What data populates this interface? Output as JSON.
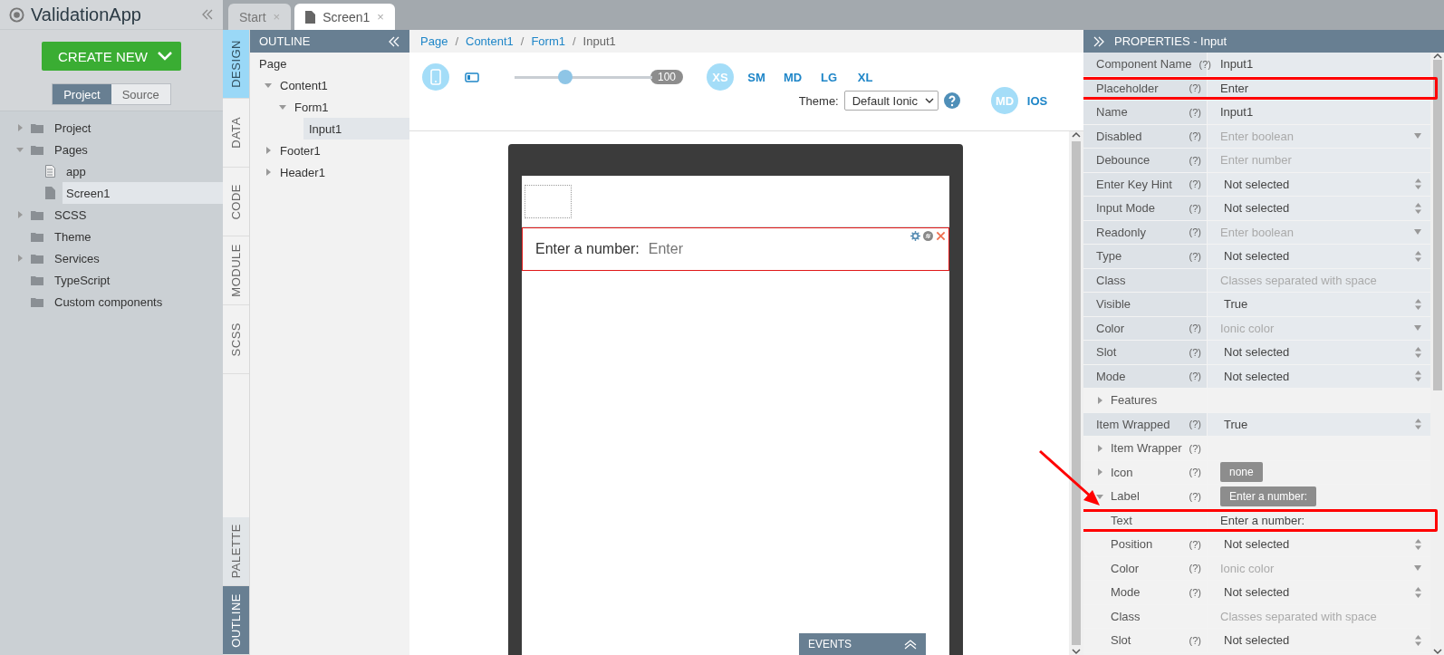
{
  "app": {
    "title": "ValidationApp",
    "create_button": "CREATE NEW",
    "source_tabs": [
      {
        "label": "Project",
        "selected": true
      },
      {
        "label": "Source",
        "selected": false
      }
    ],
    "tree": [
      {
        "label": "Project",
        "kind": "folder",
        "expanded": false,
        "selected": false
      },
      {
        "label": "Pages",
        "kind": "folder",
        "expanded": true,
        "selected": false,
        "children": [
          {
            "label": "app",
            "kind": "page",
            "selected": false
          },
          {
            "label": "Screen1",
            "kind": "file",
            "selected": true
          }
        ]
      },
      {
        "label": "SCSS",
        "kind": "folder",
        "expanded": false,
        "selected": false
      },
      {
        "label": "Theme",
        "kind": "folder",
        "selected": false
      },
      {
        "label": "Services",
        "kind": "folder",
        "expanded": false,
        "selected": false
      },
      {
        "label": "TypeScript",
        "kind": "folder",
        "selected": false
      },
      {
        "label": "Custom components",
        "kind": "folder",
        "selected": false
      }
    ]
  },
  "editor_tabs": [
    {
      "label": "Start",
      "close": "×",
      "selected": false
    },
    {
      "label": "Screen1",
      "close": "×",
      "selected": true
    }
  ],
  "mode_tabs": [
    {
      "label": "DESIGN",
      "selected": true
    },
    {
      "label": "DATA",
      "selected": false
    },
    {
      "label": "CODE",
      "selected": false
    },
    {
      "label": "MODULE",
      "selected": false
    },
    {
      "label": "SCSS",
      "selected": false
    }
  ],
  "panel_tabs": [
    {
      "label": "PALETTE",
      "selected": false
    },
    {
      "label": "OUTLINE",
      "selected": true
    }
  ],
  "outline": {
    "title": "OUTLINE",
    "tree": [
      {
        "label": "Page",
        "selected": false,
        "children": [
          {
            "label": "Content1",
            "expanded": true,
            "selected": false,
            "children": [
              {
                "label": "Form1",
                "expanded": true,
                "selected": false,
                "children": [
                  {
                    "label": "Input1",
                    "selected": true
                  }
                ]
              }
            ]
          },
          {
            "label": "Footer1",
            "expanded": false,
            "selected": false
          },
          {
            "label": "Header1",
            "expanded": false,
            "selected": false
          }
        ]
      }
    ]
  },
  "breadcrumb": [
    {
      "label": "Page",
      "link": true
    },
    {
      "separator": "/",
      "label": "Content1",
      "link": true
    },
    {
      "separator": "/",
      "label": "Form1",
      "link": true
    },
    {
      "separator": "/",
      "label": "Input1",
      "link": false
    }
  ],
  "toolbar": {
    "devices": [
      {
        "kind": "phone",
        "selected": true
      },
      {
        "kind": "tablet",
        "selected": false
      }
    ],
    "zoom": {
      "level": 0.37,
      "reading": "100"
    },
    "sizes": [
      {
        "label": "XS",
        "selected": true
      },
      {
        "label": "SM",
        "selected": false
      },
      {
        "label": "MD",
        "selected": false
      },
      {
        "label": "LG",
        "selected": false
      },
      {
        "label": "XL",
        "selected": false
      }
    ],
    "theme": {
      "label": "Theme:",
      "value": "Default Ionic"
    },
    "platforms": [
      {
        "label": "MD",
        "selected": true
      },
      {
        "label": "IOS",
        "selected": false
      }
    ]
  },
  "canvas": {
    "input": {
      "label": "Enter a number:",
      "placeholder": "Enter",
      "selected": true
    },
    "events": {
      "title": "EVENTS"
    }
  },
  "properties": {
    "title": "PROPERTIES - Input",
    "arrow_annotation": true,
    "rows": [
      {
        "label": "Component Name",
        "help": "(?)",
        "kind": "text",
        "value": "Input1",
        "highlighted": false
      },
      {
        "label": "Placeholder",
        "help": "(?)",
        "kind": "text",
        "value": "Enter",
        "highlighted": true
      },
      {
        "label": "Name",
        "help": "(?)",
        "kind": "text",
        "value": "Input1",
        "highlighted": false
      },
      {
        "label": "Disabled",
        "help": "(?)",
        "kind": "combo",
        "value": "Enter boolean",
        "highlighted": false
      },
      {
        "label": "Debounce",
        "help": "(?)",
        "kind": "hint",
        "value": "Enter number",
        "highlighted": false
      },
      {
        "label": "Enter Key Hint",
        "help": "(?)",
        "kind": "select",
        "value": "Not selected",
        "highlighted": false
      },
      {
        "label": "Input Mode",
        "help": "(?)",
        "kind": "select",
        "value": "Not selected",
        "highlighted": false
      },
      {
        "label": "Readonly",
        "help": "(?)",
        "kind": "combo",
        "value": "Enter boolean",
        "highlighted": false
      },
      {
        "label": "Type",
        "help": "(?)",
        "kind": "select",
        "value": "Not selected",
        "highlighted": false
      },
      {
        "label": "Class",
        "kind": "hint",
        "value": "Classes separated with space",
        "highlighted": false
      },
      {
        "label": "Visible",
        "kind": "select",
        "value": "True",
        "highlighted": false
      },
      {
        "label": "Color",
        "help": "(?)",
        "kind": "combo",
        "value": "Ionic color",
        "highlighted": false
      },
      {
        "label": "Slot",
        "help": "(?)",
        "kind": "select",
        "value": "Not selected",
        "highlighted": false
      },
      {
        "label": "Mode",
        "help": "(?)",
        "kind": "select",
        "value": "Not selected",
        "highlighted": false
      },
      {
        "label": "Features",
        "kind": "group",
        "expanded": false,
        "highlighted": false
      },
      {
        "label": "Item Wrapped",
        "help": "(?)",
        "kind": "select",
        "value": "True",
        "highlighted": false
      },
      {
        "label": "Item Wrapper",
        "help": "(?)",
        "kind": "group",
        "expanded": false,
        "highlighted": false
      },
      {
        "label": "Icon",
        "help": "(?)",
        "kind": "group",
        "chip": "none",
        "expanded": false,
        "highlighted": false
      },
      {
        "label": "Label",
        "help": "(?)",
        "kind": "group",
        "chip": "Enter a number:",
        "expanded": true,
        "highlighted": false,
        "children": [
          {
            "label": "Text",
            "kind": "text",
            "value": "Enter a number:",
            "highlighted": true
          },
          {
            "label": "Position",
            "help": "(?)",
            "kind": "select",
            "value": "Not selected",
            "highlighted": false
          },
          {
            "label": "Color",
            "help": "(?)",
            "kind": "combo",
            "value": "Ionic color",
            "highlighted": false
          },
          {
            "label": "Mode",
            "help": "(?)",
            "kind": "select",
            "value": "Not selected",
            "highlighted": false
          },
          {
            "label": "Class",
            "kind": "hint",
            "value": "Classes separated with space",
            "highlighted": false
          },
          {
            "label": "Slot",
            "help": "(?)",
            "kind": "select",
            "value": "Not selected",
            "highlighted": false
          }
        ]
      }
    ]
  }
}
